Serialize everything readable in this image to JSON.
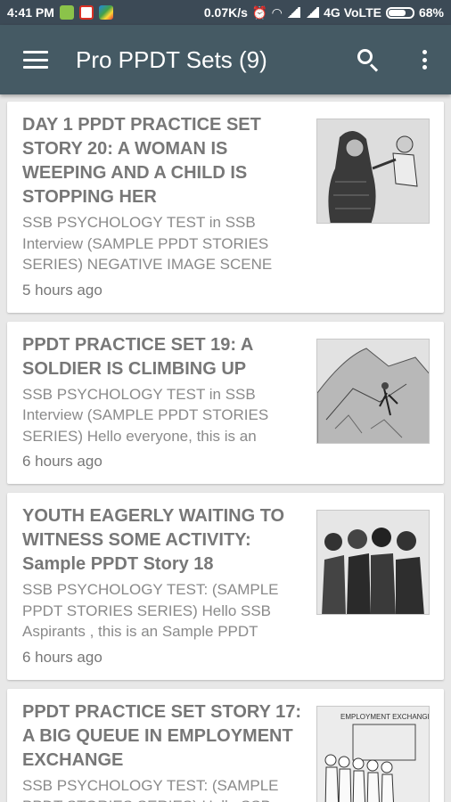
{
  "statusbar": {
    "time": "4:41 PM",
    "speed": "0.07K/s",
    "network": "4G VoLTE",
    "battery_level": 0.68,
    "battery": "68%"
  },
  "appbar": {
    "title": "Pro PPDT Sets (9)"
  },
  "posts": [
    {
      "title": "DAY 1 PPDT PRACTICE SET STORY 20: A WOMAN IS WEEPING AND A CHILD IS STOPPING HER",
      "snippet": "SSB PSYCHOLOGY TEST in SSB Interview (SAMPLE  PPDT STORIES SERIES) NEGATIVE IMAGE SCENE",
      "time": "5 hours ago"
    },
    {
      "title": "PPDT PRACTICE SET 19: A SOLDIER IS CLIMBING UP",
      "snippet": "SSB PSYCHOLOGY TEST in SSB Interview (SAMPLE  PPDT STORIES SERIES) Hello everyone, this is an",
      "time": "6 hours ago"
    },
    {
      "title": "YOUTH EAGERLY WAITING TO WITNESS SOME ACTIVITY: Sample PPDT Story 18",
      "snippet": "SSB PSYCHOLOGY TEST:  (SAMPLE  PPDT STORIES SERIES) Hello  SSB Aspirants , this is an  Sample PPDT",
      "time": "6 hours ago"
    },
    {
      "title": "PPDT PRACTICE SET STORY 17: A BIG QUEUE IN EMPLOYMENT EXCHANGE",
      "snippet": "SSB PSYCHOLOGY TEST:  (SAMPLE  PPDT STORIES SERIES) Hello  SSB",
      "time": "",
      "thumb_caption": "EMPLOYMENT EXCHANGE"
    }
  ]
}
